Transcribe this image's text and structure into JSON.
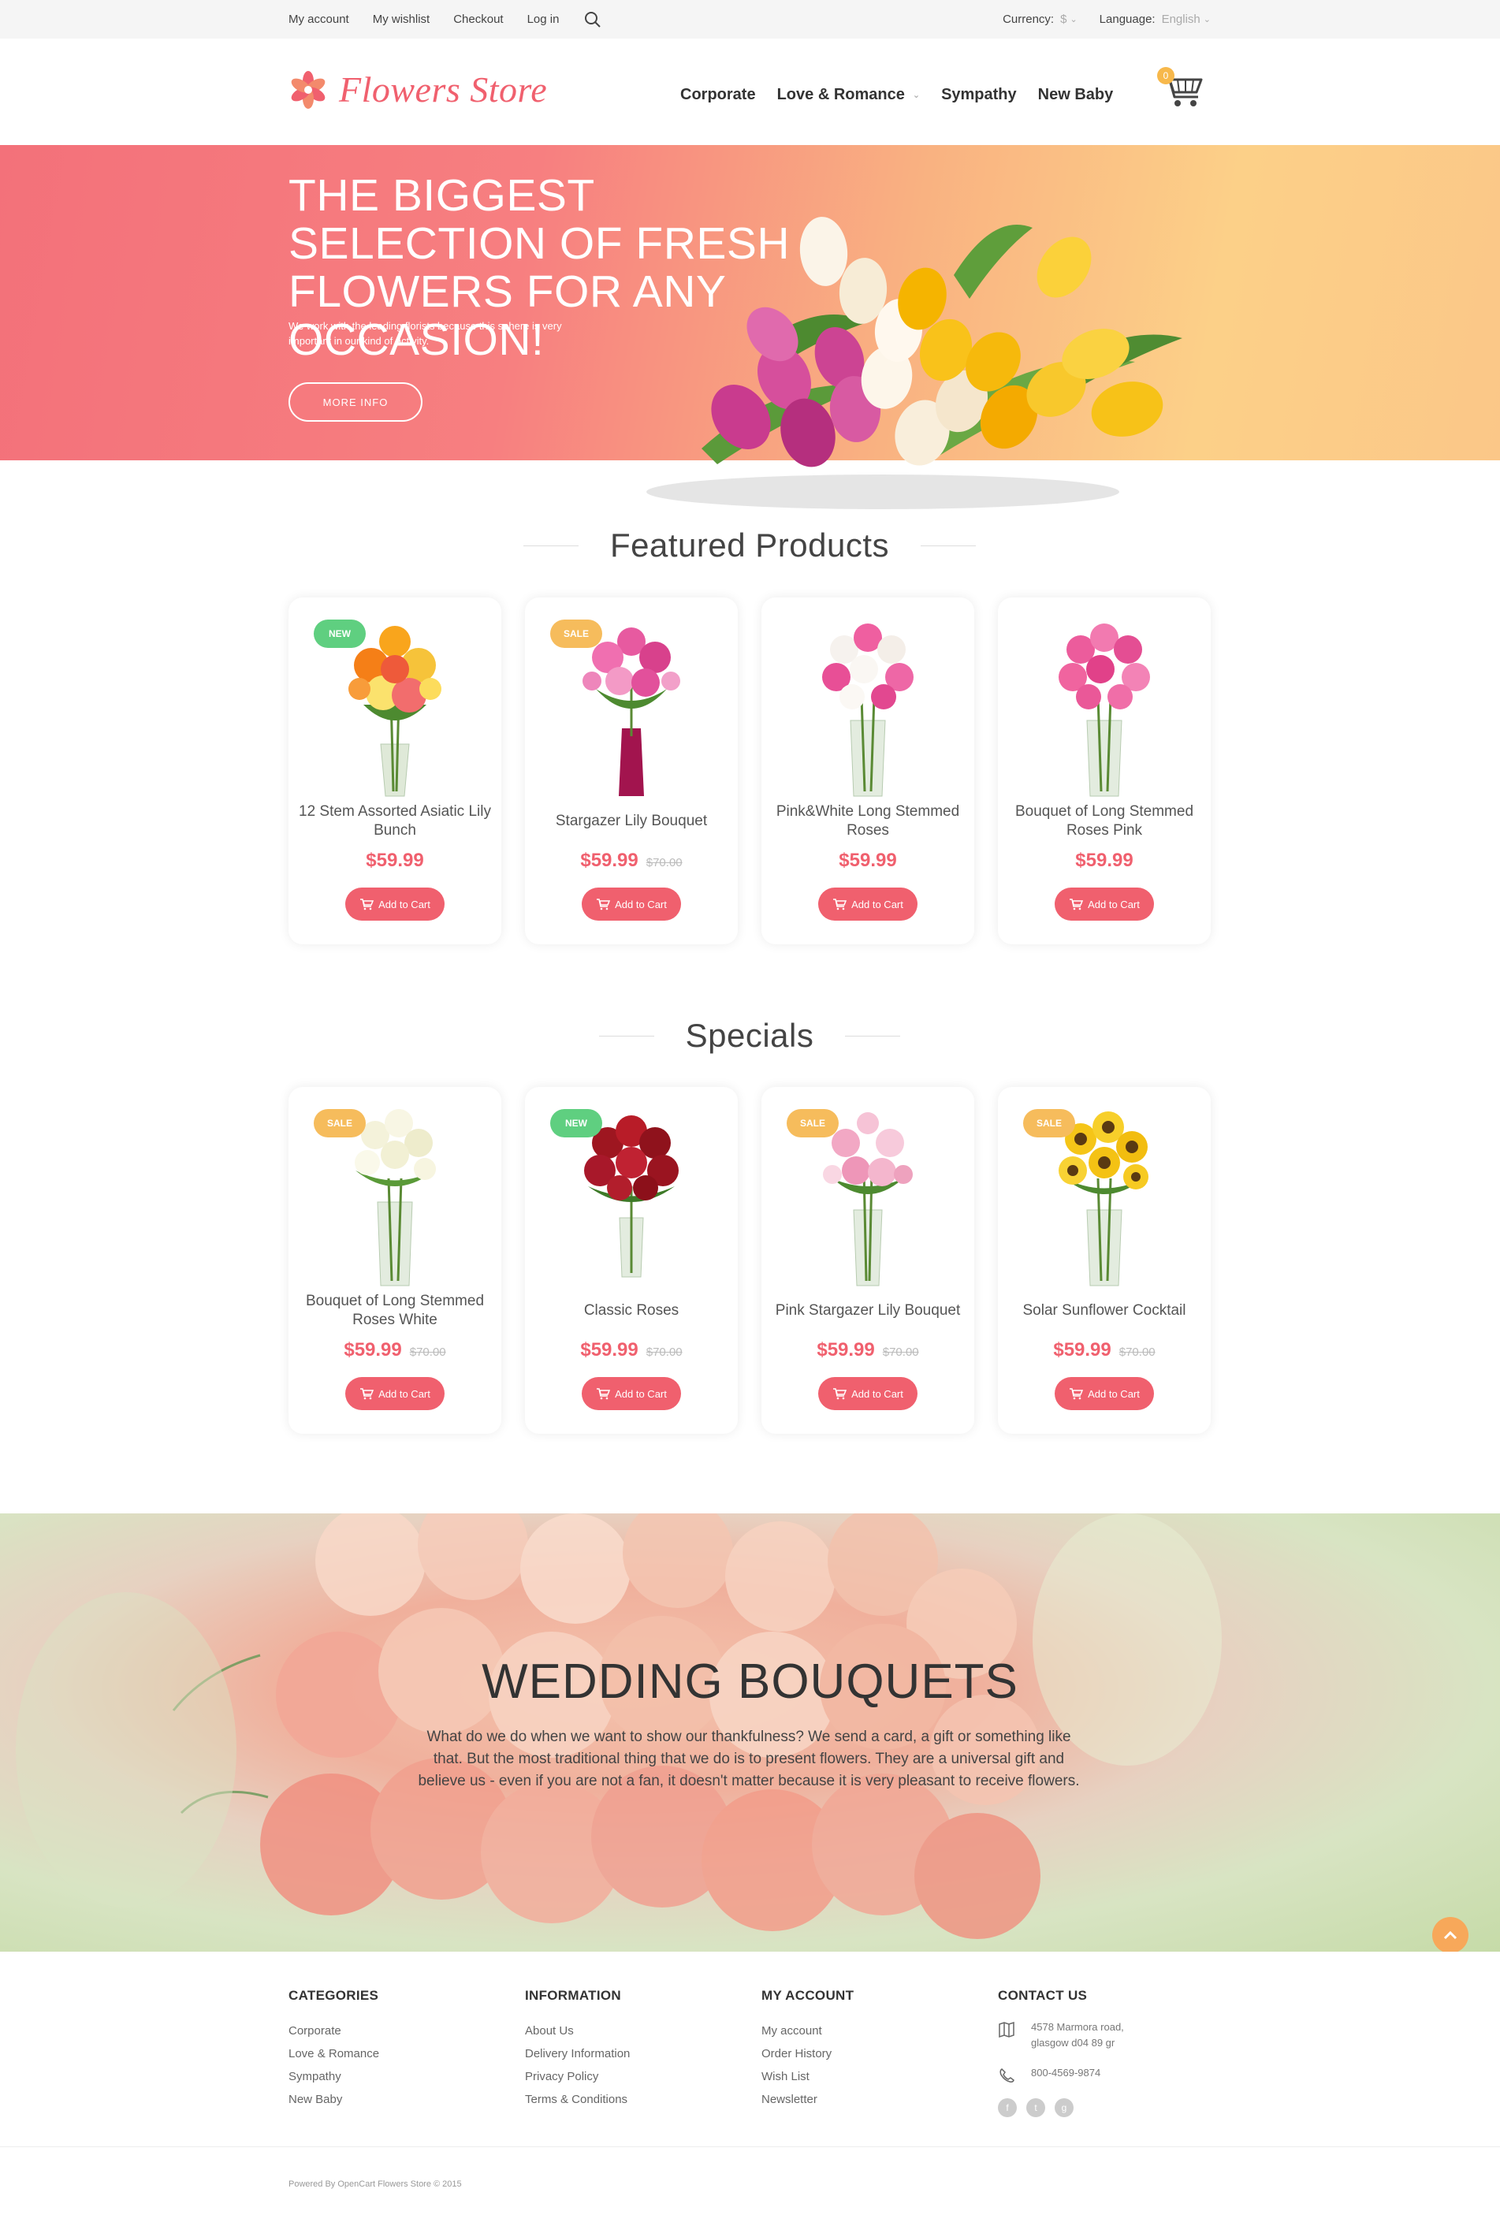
{
  "topbar": {
    "links": [
      "My account",
      "My wishlist",
      "Checkout",
      "Log in"
    ],
    "currency_label": "Currency:",
    "currency_value": "$",
    "language_label": "Language:",
    "language_value": "English"
  },
  "header": {
    "logo_text": "Flowers Store",
    "nav": [
      "Corporate",
      "Love & Romance",
      "Sympathy",
      "New Baby"
    ],
    "cart_count": "0"
  },
  "hero": {
    "headline": "THE BIGGEST SELECTION OF FRESH FLOWERS FOR ANY OCCASION!",
    "subtext": "We work with the leading florists because this sphere is very important in our kind of activity.",
    "button": "MORE INFO"
  },
  "featured": {
    "title": "Featured Products",
    "products": [
      {
        "name": "12 Stem Assorted Asiatic Lily Bunch",
        "price": "$59.99",
        "old_price": "",
        "badge": "NEW",
        "add_label": "Add to Cart"
      },
      {
        "name": "Stargazer Lily Bouquet",
        "price": "$59.99",
        "old_price": "$70.00",
        "badge": "SALE",
        "add_label": "Add to Cart"
      },
      {
        "name": "Pink&White Long Stemmed Roses",
        "price": "$59.99",
        "old_price": "",
        "badge": "",
        "add_label": "Add to Cart"
      },
      {
        "name": "Bouquet of Long Stemmed Roses Pink",
        "price": "$59.99",
        "old_price": "",
        "badge": "",
        "add_label": "Add to Cart"
      }
    ]
  },
  "specials": {
    "title": "Specials",
    "products": [
      {
        "name": "Bouquet of Long Stemmed Roses White",
        "price": "$59.99",
        "old_price": "$70.00",
        "badge": "SALE",
        "add_label": "Add to Cart"
      },
      {
        "name": "Classic Roses",
        "price": "$59.99",
        "old_price": "$70.00",
        "badge": "NEW",
        "add_label": "Add to Cart"
      },
      {
        "name": "Pink Stargazer Lily Bouquet",
        "price": "$59.99",
        "old_price": "$70.00",
        "badge": "SALE",
        "add_label": "Add to Cart"
      },
      {
        "name": "Solar Sunflower Cocktail",
        "price": "$59.99",
        "old_price": "$70.00",
        "badge": "SALE",
        "add_label": "Add to Cart"
      }
    ]
  },
  "wedding": {
    "title": "WEDDING BOUQUETS",
    "text": "What do we do when we want to show our thankfulness? We send a card, a gift or something like that. But the most traditional thing that we do is to present flowers. They are a universal gift and believe us - even if you are not a fan, it doesn't matter because it is very pleasant to receive flowers."
  },
  "footer": {
    "categories": {
      "title": "CATEGORIES",
      "items": [
        "Corporate",
        "Love & Romance",
        "Sympathy",
        "New Baby"
      ]
    },
    "information": {
      "title": "INFORMATION",
      "items": [
        "About Us",
        "Delivery Information",
        "Privacy Policy",
        "Terms & Conditions"
      ]
    },
    "account": {
      "title": "MY ACCOUNT",
      "items": [
        "My account",
        "Order History",
        "Wish List",
        "Newsletter"
      ]
    },
    "contact": {
      "title": "CONTACT US",
      "address_line1": "4578 Marmora road,",
      "address_line2": "glasgow d04 89 gr",
      "phone": "800-4569-9874",
      "social": [
        "f",
        "t",
        "g"
      ]
    },
    "copyright": "Powered By OpenCart Flowers Store © 2015"
  },
  "colors": {
    "accent": "#f0606e",
    "new_badge": "#5fcf80",
    "sale_badge": "#f6bc5c",
    "to_top": "#f7a85a"
  },
  "icons": {
    "search": "search-icon",
    "cart": "cart-icon",
    "logo": "flower-logo-icon",
    "to_top": "chevron-up-icon",
    "address": "map-icon",
    "phone": "phone-icon"
  }
}
